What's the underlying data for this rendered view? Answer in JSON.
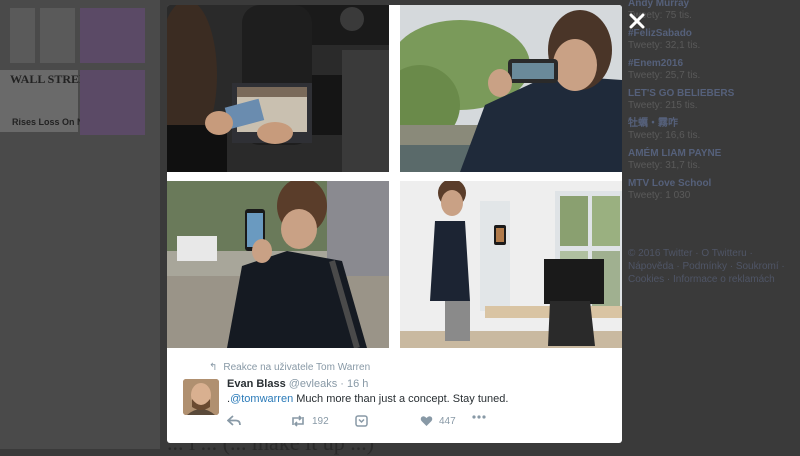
{
  "background": {
    "newspaper_masthead": "WALL STREET JOU",
    "newspaper_headline": "Rises Loss On New",
    "bottom_caption": "... i ... (... make it up ...)",
    "trends": [
      {
        "name": "Andy Murray",
        "count": "Tweety: 75 tis."
      },
      {
        "name": "#FelizSabado",
        "count": "Tweety: 32,1 tis."
      },
      {
        "name": "#Enem2016",
        "count": "Tweety: 25,7 tis."
      },
      {
        "name": "LET'S GO BELIEBERS",
        "count": "Tweety: 215 tis."
      },
      {
        "name": "牡蠣・霧咋",
        "count": "Tweety: 16,6 tis."
      },
      {
        "name": "AMÉM LIAM PAYNE",
        "count": "Tweety: 31,7 tis."
      },
      {
        "name": "MTV Love School",
        "count": "Tweety: 1 030"
      }
    ],
    "footer": "© 2016 Twitter · O Twitteru · Nápověda · Podmínky · Soukromí · Cookies · Informace o reklamách"
  },
  "modal": {
    "close_label": "✕",
    "reply_context": "Reakce na uživatele Tom Warren",
    "tweet": {
      "name": "Evan Blass",
      "handle": "@evleaks",
      "time": "· 16 h",
      "text_prefix": ".",
      "mention": "@tomwarren",
      "text": " Much more than just a concept. Stay tuned.",
      "retweets": "192",
      "likes": "447"
    }
  },
  "colors": {
    "accent": "#2b7bb9",
    "muted": "#8899a6"
  }
}
